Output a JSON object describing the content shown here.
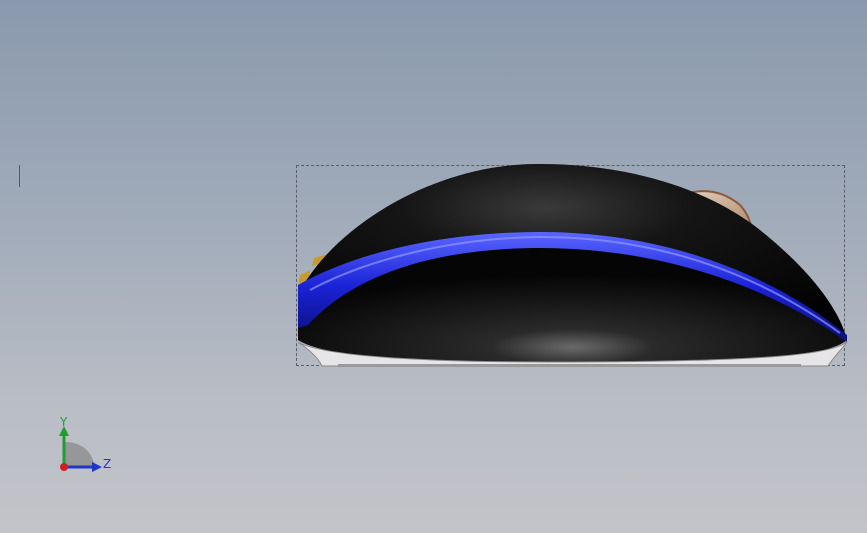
{
  "viewport": {
    "background_top": "#8a99ad",
    "background_bottom": "#c3c4c9"
  },
  "model": {
    "body_color": "#0a0a0a",
    "stripe_color": "#1a22d6",
    "wheel_color": "#c8a58a",
    "accent_color": "#c79a2c"
  },
  "triad": {
    "y_label": "Y",
    "z_label": "Z",
    "y_color": "#1f9e2f",
    "z_color": "#2135c9",
    "origin_color": "#d22020"
  }
}
